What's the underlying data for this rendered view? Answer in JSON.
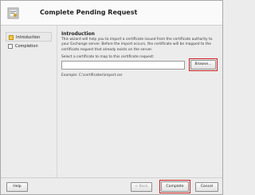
{
  "header": {
    "title": "Complete Pending Request"
  },
  "nav": {
    "items": [
      {
        "label": "Introduction"
      },
      {
        "label": "Completion"
      }
    ]
  },
  "intro": {
    "heading": "Introduction",
    "description": "This wizard will help you to import a certificate issued from the certificate authority to your Exchange server. Before the import occurs, the certificate will be mapped to the certificate request that already exists on the server."
  },
  "certificate": {
    "label": "Select a certificate to map to this certificate request:",
    "value": "",
    "browse_label": "Browse...",
    "example": "Example: C:\\certificates\\import.cer"
  },
  "footer": {
    "help_label": "Help",
    "back_label": "< Back",
    "complete_label": "Complete",
    "cancel_label": "Cancel"
  }
}
